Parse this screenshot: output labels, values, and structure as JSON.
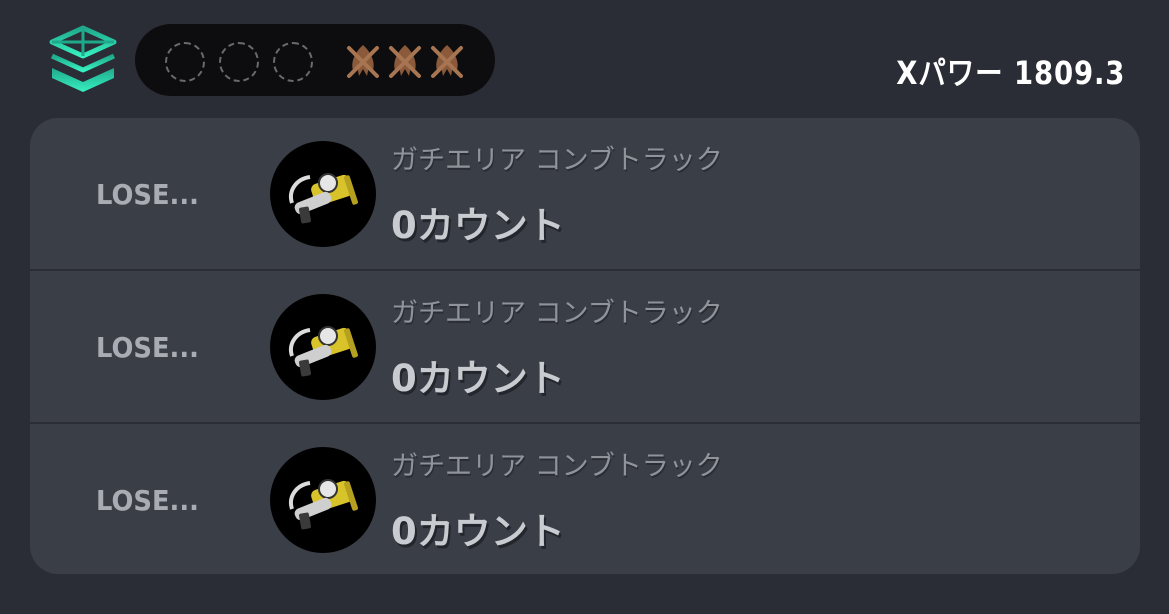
{
  "header": {
    "mode_icon": "splat-zones-icon",
    "win_slots": [
      "empty",
      "empty",
      "empty"
    ],
    "loss_marks": [
      "squid-crossed-icon",
      "squid-crossed-icon",
      "squid-crossed-icon"
    ],
    "xpower_text": "Xパワー 1809.3"
  },
  "battles": [
    {
      "result": "LOSE...",
      "weapon_icon": "blaster-weapon-icon",
      "stage": "ガチエリア コンブトラック",
      "score": "0カウント"
    },
    {
      "result": "LOSE...",
      "weapon_icon": "blaster-weapon-icon",
      "stage": "ガチエリア コンブトラック",
      "score": "0カウント"
    },
    {
      "result": "LOSE...",
      "weapon_icon": "blaster-weapon-icon",
      "stage": "ガチエリア コンブトラック",
      "score": "0カウント"
    }
  ],
  "colors": {
    "background": "#2a2d35",
    "card": "#3a3e47",
    "accent_teal": "#2fe0b0",
    "loss_mark": "#8a5a3a",
    "weapon_yellow": "#d8c32a"
  }
}
